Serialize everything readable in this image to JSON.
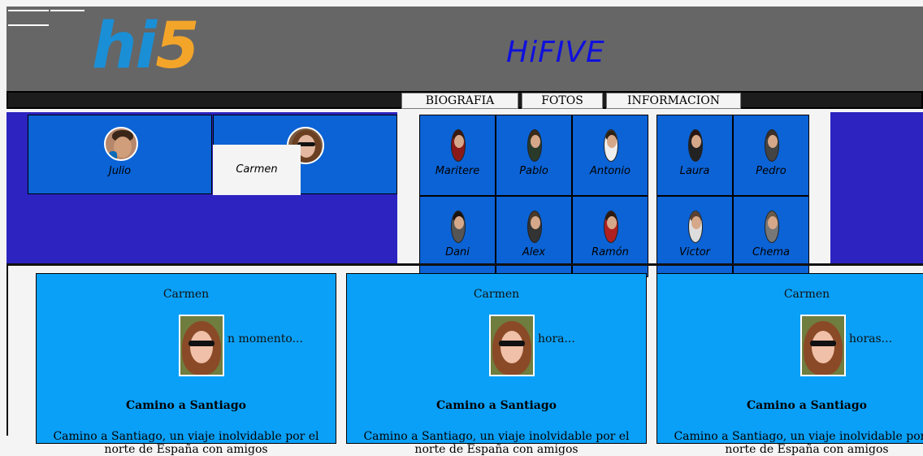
{
  "header": {
    "logo_hi": "hi",
    "logo_five": "5",
    "site_title": "HiFIVE"
  },
  "nav": {
    "tabs": [
      "BIOGRAFIA",
      "FOTOS",
      "INFORMACION"
    ]
  },
  "friends": {
    "featured": [
      "Julio",
      "Carmen"
    ],
    "grid": [
      "Maritere",
      "Pablo",
      "Antonio",
      "Laura",
      "Pedro",
      "Dani",
      "Alex",
      "Ramón",
      "Victor",
      "Chema"
    ]
  },
  "posts": [
    {
      "author": "Carmen",
      "time": "n momento...",
      "title": "Camino a Santiago",
      "body": "Camino a Santiago, un viaje inolvidable por el norte de España con amigos"
    },
    {
      "author": "Carmen",
      "time": "hora...",
      "title": "Camino a Santiago",
      "body": "Camino a Santiago, un viaje inolvidable por el norte de España con amigos"
    },
    {
      "author": "Carmen",
      "time": "horas...",
      "title": "Camino a Santiago",
      "body": "Camino a Santiago, un viaje inolvidable por el norte de España con amigos"
    }
  ],
  "colors": {
    "header_bg": "#666666",
    "band_bg": "#2c23c0",
    "card_bg": "#0b63d6",
    "post_bg": "#0aa0f7",
    "logo_blue": "#1a8fd6",
    "logo_orange": "#f3a52a"
  }
}
